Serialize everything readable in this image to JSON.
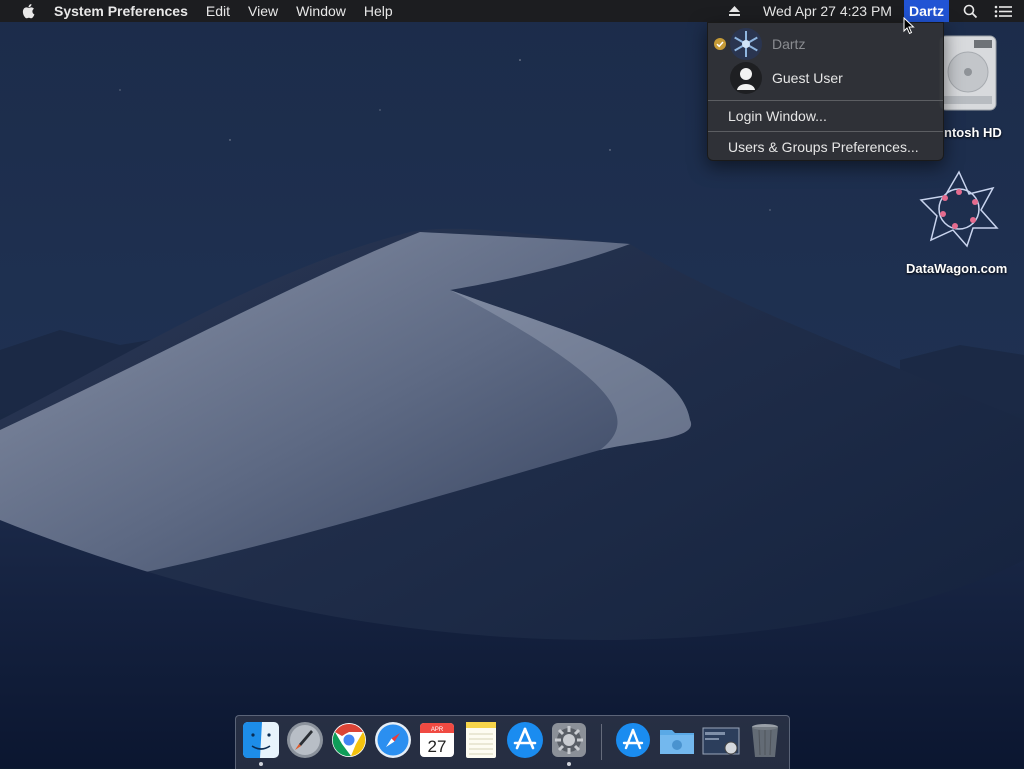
{
  "menubar": {
    "app_name": "System Preferences",
    "menus": [
      "Edit",
      "View",
      "Window",
      "Help"
    ],
    "datetime": "Wed Apr 27  4:23 PM",
    "user": "Dartz",
    "icons": [
      "apple-icon",
      "eject-icon",
      "spotlight-search-icon",
      "notification-center-icon"
    ]
  },
  "user_menu": {
    "users": [
      {
        "name": "Dartz",
        "current": true,
        "avatar": "snowflake-avatar"
      },
      {
        "name": "Guest User",
        "current": false,
        "avatar": "silhouette-avatar"
      }
    ],
    "login_window": "Login Window...",
    "prefs": "Users & Groups Preferences..."
  },
  "desktop": {
    "icons": [
      {
        "label": "ntosh HD",
        "icon": "hard-drive-icon"
      },
      {
        "label": "DataWagon.com",
        "icon": "datawagon-star-icon"
      }
    ]
  },
  "dock": {
    "apps": [
      {
        "name": "Finder",
        "icon": "finder-icon",
        "running": true
      },
      {
        "name": "Launchpad",
        "icon": "launchpad-icon",
        "running": false
      },
      {
        "name": "Chrome",
        "icon": "chrome-icon",
        "running": false
      },
      {
        "name": "Safari",
        "icon": "safari-icon",
        "running": false
      },
      {
        "name": "Calendar",
        "icon": "calendar-icon",
        "running": false
      },
      {
        "name": "Notes",
        "icon": "notes-icon",
        "running": false
      },
      {
        "name": "App Store",
        "icon": "app-store-icon",
        "running": false
      },
      {
        "name": "System Preferences",
        "icon": "system-preferences-icon",
        "running": true
      },
      {
        "name": "Applications",
        "icon": "applications-stack-icon",
        "running": false
      },
      {
        "name": "Downloads",
        "icon": "downloads-folder-icon",
        "running": false
      },
      {
        "name": "Screenshot",
        "icon": "screenshot-stack-icon",
        "running": false
      },
      {
        "name": "Trash",
        "icon": "trash-icon",
        "running": false
      }
    ],
    "calendar": {
      "month": "APR",
      "day": "27"
    }
  },
  "colors": {
    "selection": "#2154d4",
    "menubar": "#1c1d20",
    "menu_bg": "#303236"
  }
}
